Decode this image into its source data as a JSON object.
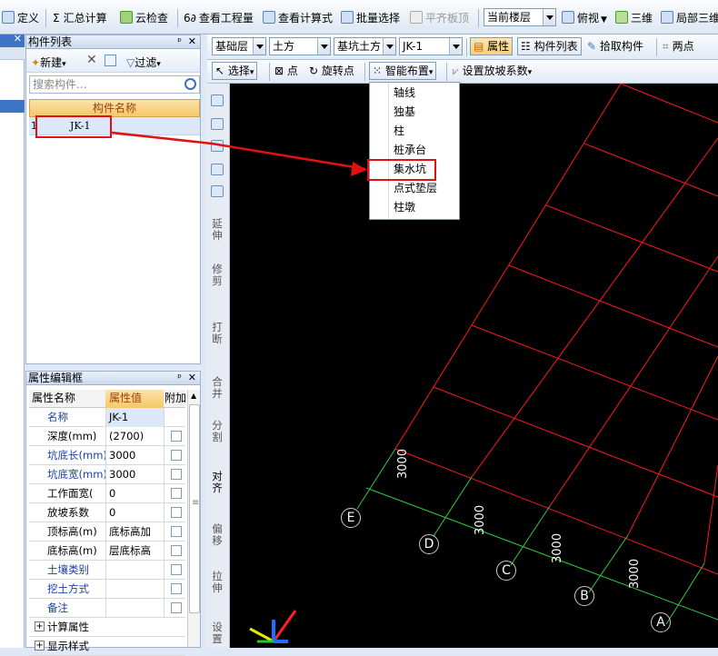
{
  "top_toolbar": {
    "define": "定义",
    "summary_calc": "汇总计算",
    "cloud_check": "云检查",
    "view_quantity": "查看工程量",
    "view_formula": "查看计算式",
    "batch_select": "批量选择",
    "align_slab_top": "平齐板顶",
    "floor_select": "当前楼层",
    "view_mode": "俯视",
    "three_d": "三维",
    "local_3d": "局部三维"
  },
  "layer_row": {
    "floor": "基础层",
    "category": "土方",
    "subtype": "基坑土方",
    "component": "JK-1",
    "properties_btn": "属性",
    "component_list_btn": "构件列表",
    "pick_component_btn": "拾取构件",
    "two_points_btn": "两点"
  },
  "draw_row": {
    "select_btn": "选择",
    "point_btn": "点",
    "rotate_point_btn": "旋转点",
    "smart_layout_btn": "智能布置",
    "slope_coeff_btn": "设置放坡系数"
  },
  "smart_layout_menu": {
    "items": [
      "轴线",
      "独基",
      "柱",
      "桩承台",
      "集水坑",
      "点式垫层",
      "柱墩"
    ],
    "highlighted": "集水坑"
  },
  "component_list": {
    "title": "构件列表",
    "new_btn": "新建",
    "filter_btn": "过滤",
    "search_placeholder": "搜索构件...",
    "column_header": "构件名称",
    "rows": [
      {
        "index": "1",
        "name": "JK-1"
      }
    ]
  },
  "property_editor": {
    "title": "属性编辑框",
    "col_name": "属性名称",
    "col_value": "属性值",
    "col_extra": "附加",
    "rows": [
      {
        "name": "名称",
        "value": "JK-1"
      },
      {
        "name": "深度(mm)",
        "value": "(2700)"
      },
      {
        "name": "坑底长(mm)",
        "value": "3000"
      },
      {
        "name": "坑底宽(mm)",
        "value": "3000"
      },
      {
        "name": "工作面宽(",
        "value": "0"
      },
      {
        "name": "放坡系数",
        "value": "0"
      },
      {
        "name": "顶标高(m)",
        "value": "底标高加"
      },
      {
        "name": "底标高(m)",
        "value": "层底标高"
      },
      {
        "name": "土壤类别",
        "value": ""
      },
      {
        "name": "挖土方式",
        "value": ""
      },
      {
        "name": "备注",
        "value": ""
      },
      {
        "name": "计算属性",
        "value": ""
      },
      {
        "name": "显示样式",
        "value": ""
      }
    ]
  },
  "vertical_tools": {
    "extend": "延伸",
    "trim": "修剪",
    "break": "打断",
    "merge": "合并",
    "split": "分割",
    "align": "对齐",
    "offset": "偏移",
    "stretch": "拉伸",
    "setup": "设置"
  },
  "canvas": {
    "axis_labels": [
      "E",
      "D",
      "C",
      "B",
      "A"
    ],
    "dimension_labels": [
      "3000",
      "3000",
      "3000",
      "3000"
    ]
  },
  "colors": {
    "grid_line": "#ff1a1a",
    "dimension_line": "#2ecc40",
    "annotation": "#e31010",
    "canvas_bg": "#000000",
    "header_orange": "#f5c86a"
  }
}
